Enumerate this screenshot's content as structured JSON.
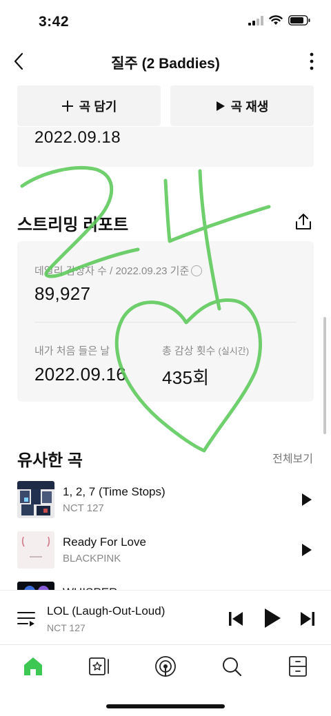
{
  "status_bar": {
    "time": "3:42"
  },
  "nav": {
    "title": "질주 (2 Baddies)"
  },
  "actions": {
    "add_label": "곡 담기",
    "play_label": "곡 재생"
  },
  "release": {
    "date": "2022.09.18"
  },
  "report": {
    "title": "스트리밍 리포트",
    "daily_label": "데일리 감상자 수 / 2022.09.23 기준",
    "daily_value": "89,927",
    "first_listen_label": "내가 처음 들은 날",
    "first_listen_value": "2022.09.16",
    "total_plays_label": "총 감상 횟수",
    "total_plays_realtime": "(실시간)",
    "total_plays_value": "435회"
  },
  "similar": {
    "title": "유사한 곡",
    "see_all": "전체보기",
    "songs": [
      {
        "title": "1, 2, 7 (Time Stops)",
        "artist": "NCT 127"
      },
      {
        "title": "Ready For Love",
        "artist": "BLACKPINK"
      },
      {
        "title": "WHISPER",
        "artist": ""
      }
    ]
  },
  "mini_player": {
    "title": "LOL (Laugh-Out-Loud)",
    "artist": "NCT 127"
  },
  "tabs": [
    "home-icon",
    "library-icon",
    "podcast-icon",
    "search-icon",
    "storage-icon"
  ],
  "colors": {
    "accent": "#3dc753",
    "doodle": "#5cc95a",
    "text": "#111111",
    "muted": "#888888",
    "card": "#f6f6f6"
  }
}
